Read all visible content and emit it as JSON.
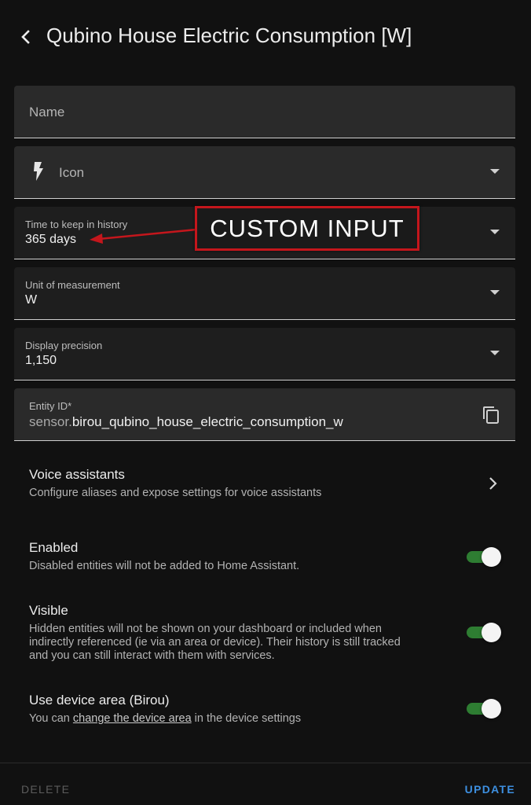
{
  "header": {
    "title": "Qubino House Electric Consumption [W]"
  },
  "fields": {
    "name": {
      "placeholder": "Name"
    },
    "icon": {
      "label": "Icon",
      "icon_name": "flash-icon"
    },
    "history": {
      "label": "Time to keep in history",
      "value": "365 days"
    },
    "unit": {
      "label": "Unit of measurement",
      "value": "W"
    },
    "precision": {
      "label": "Display precision",
      "value": "1,150"
    },
    "entity_id": {
      "label": "Entity ID*",
      "prefix": "sensor.",
      "value": "birou_qubino_house_electric_consumption_w"
    }
  },
  "annotation": {
    "text": "CUSTOM INPUT",
    "color": "#c4161c"
  },
  "voice": {
    "title": "Voice assistants",
    "subtitle": "Configure aliases and expose settings for voice assistants"
  },
  "enabled": {
    "title": "Enabled",
    "subtitle": "Disabled entities will not be added to Home Assistant.",
    "on": true
  },
  "visible": {
    "title": "Visible",
    "subtitle_line1": "Hidden entities will not be shown on your dashboard or included when",
    "subtitle_line2": "indirectly referenced (ie via an area or device). Their history is still tracked",
    "subtitle_line3": "and you can still interact with them with services.",
    "on": true
  },
  "device_area": {
    "title": "Use device area (Birou)",
    "subtitle_pre": "You can ",
    "subtitle_link": "change the device area",
    "subtitle_post": " in the device settings",
    "on": true
  },
  "footer": {
    "delete_label": "DELETE",
    "update_label": "UPDATE"
  },
  "colors": {
    "toggle_on": "#2e7d32",
    "primary": "#3d8fe0"
  }
}
